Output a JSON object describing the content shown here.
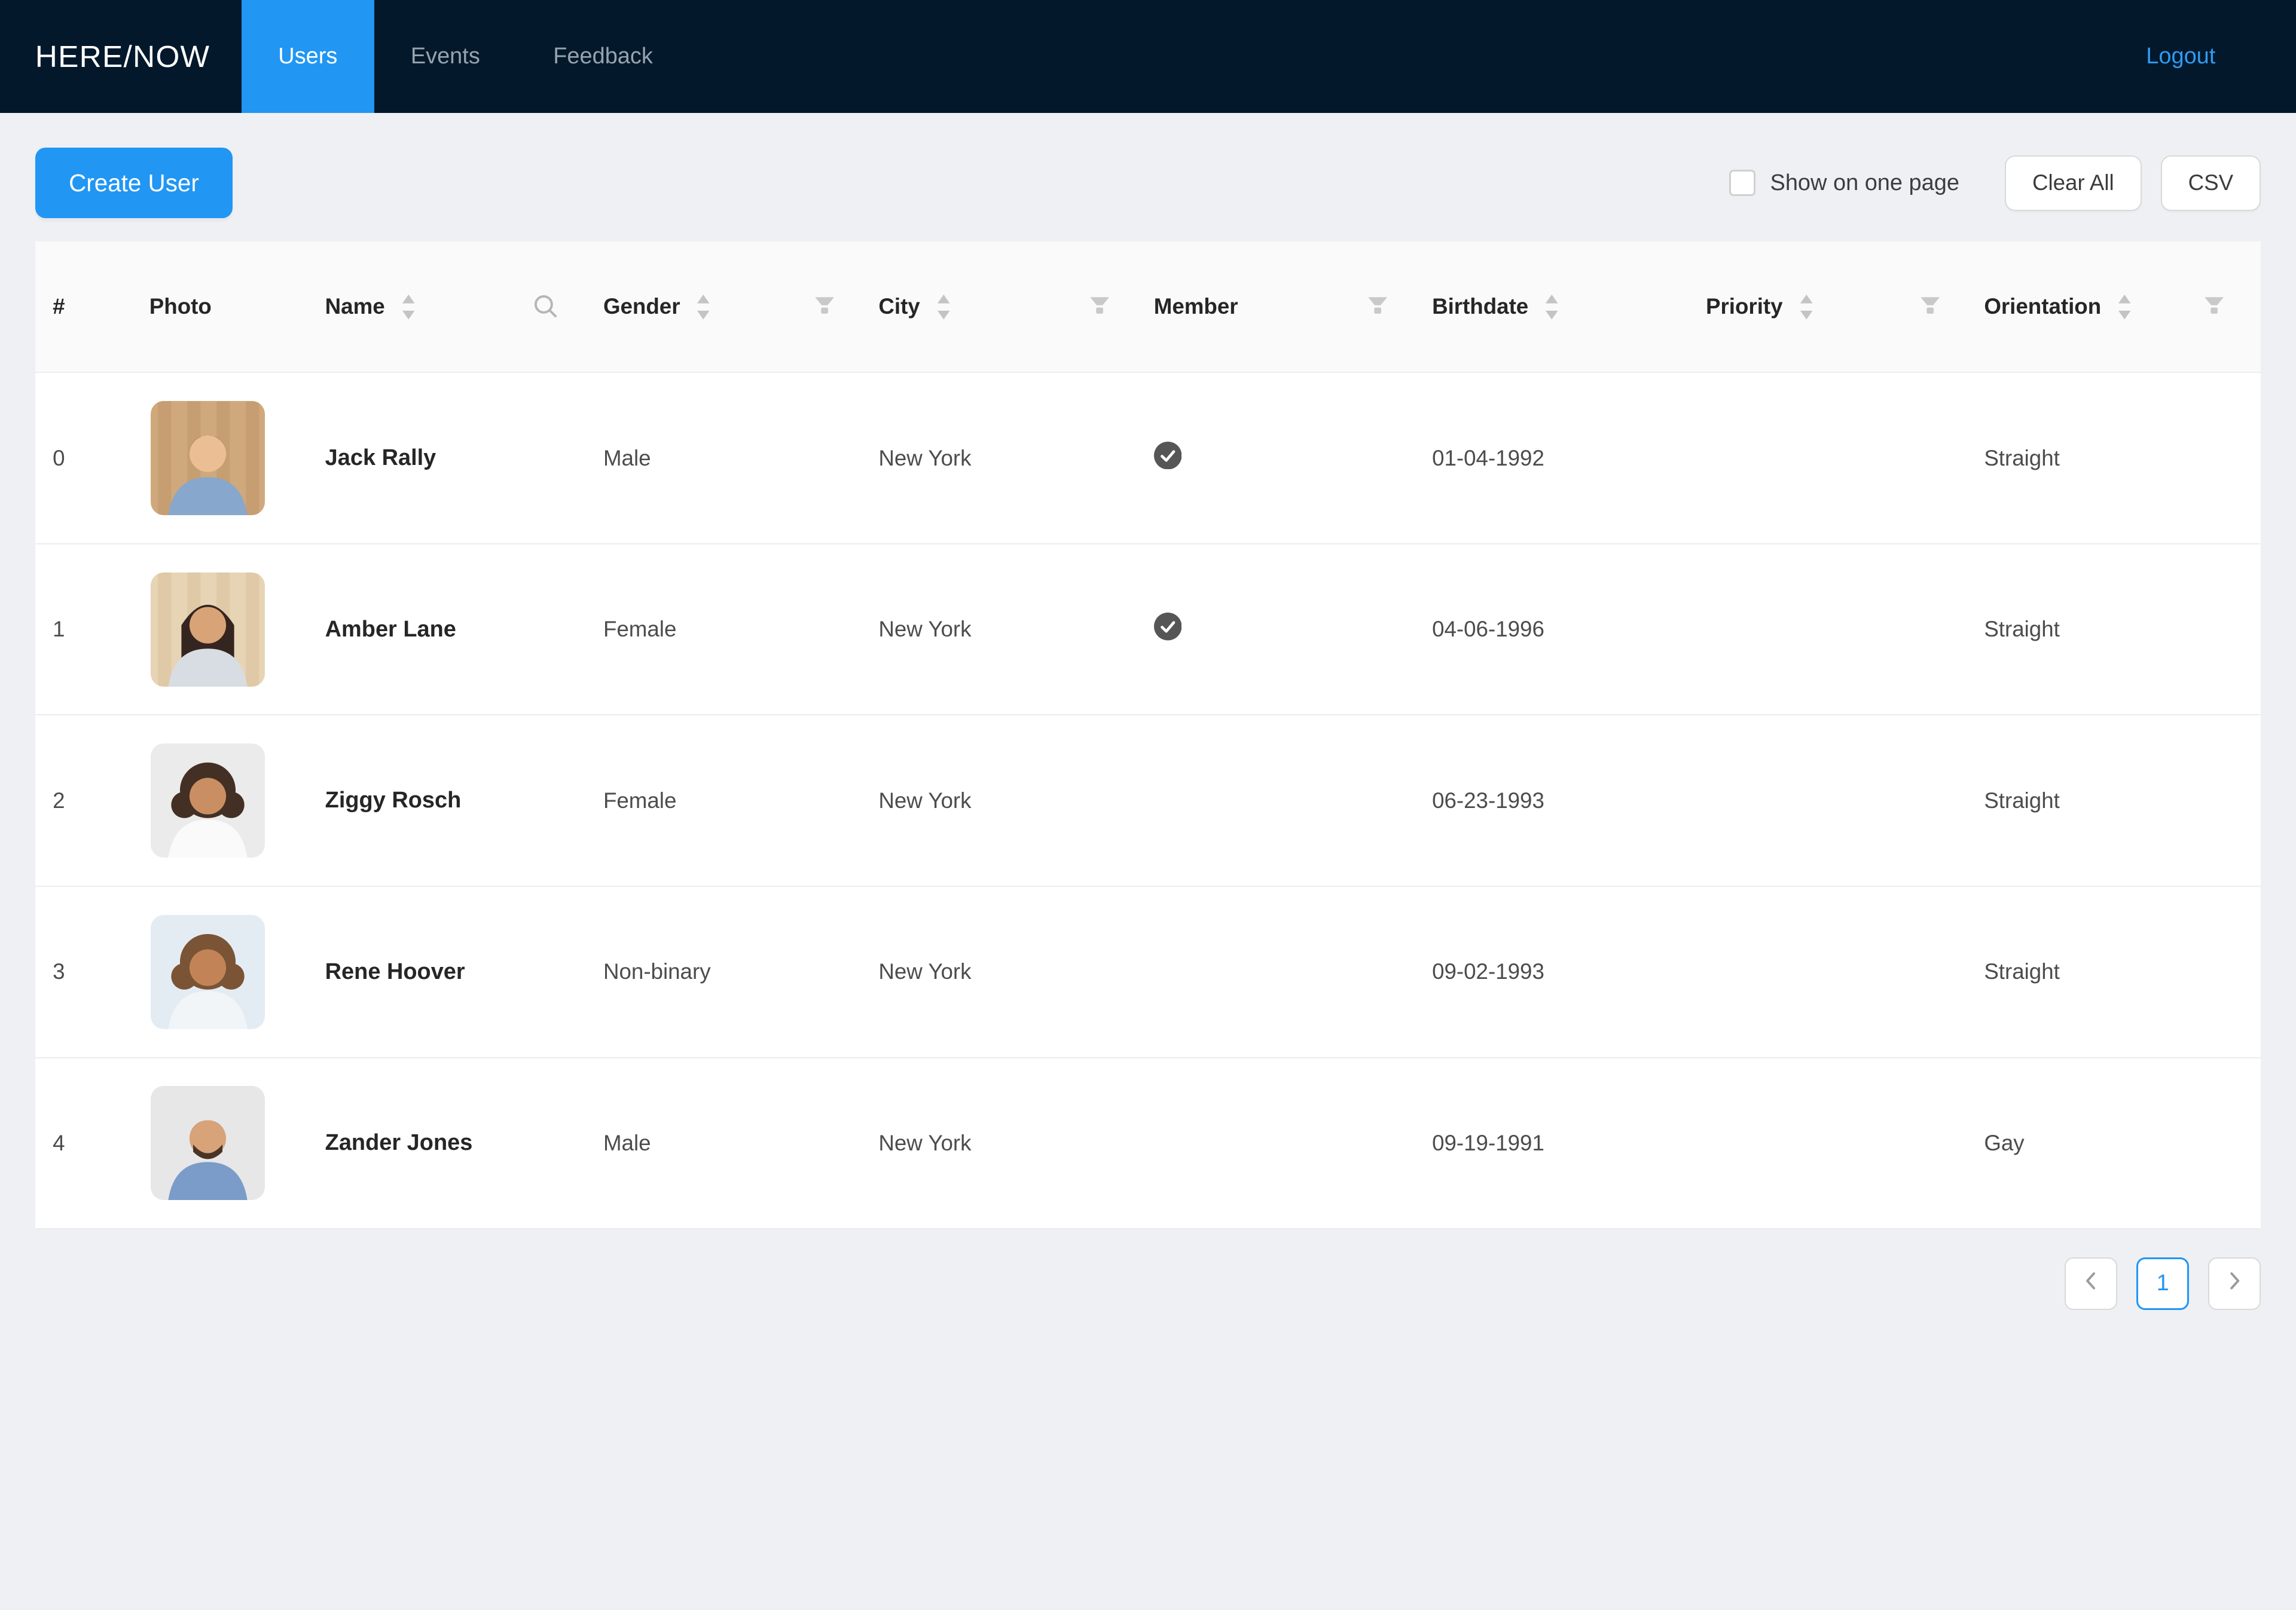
{
  "navbar": {
    "logo": "HERE/NOW",
    "tabs": [
      {
        "label": "Users",
        "active": true
      },
      {
        "label": "Events",
        "active": false
      },
      {
        "label": "Feedback",
        "active": false
      }
    ],
    "logout_label": "Logout",
    "colors": {
      "bg": "#04182b",
      "accent": "#2196f3",
      "inactive_tab_text": "#97a3ae"
    }
  },
  "toolbar": {
    "create_user_label": "Create User",
    "show_on_one_page_label": "Show on one page",
    "show_on_one_page_checked": false,
    "clear_all_label": "Clear All",
    "csv_label": "CSV"
  },
  "table": {
    "columns": [
      {
        "key": "index",
        "label": "#"
      },
      {
        "key": "photo",
        "label": "Photo"
      },
      {
        "key": "name",
        "label": "Name",
        "sorter": true,
        "search": true
      },
      {
        "key": "gender",
        "label": "Gender",
        "sorter": true,
        "filter": true
      },
      {
        "key": "city",
        "label": "City",
        "sorter": true,
        "filter": true
      },
      {
        "key": "member",
        "label": "Member",
        "filter": true
      },
      {
        "key": "birthdate",
        "label": "Birthdate",
        "sorter": true
      },
      {
        "key": "priority",
        "label": "Priority",
        "sorter": true,
        "filter": true
      },
      {
        "key": "orientation",
        "label": "Orientation",
        "sorter": true,
        "filter": true
      }
    ],
    "rows": [
      {
        "index": "0",
        "name": "Jack Rally",
        "gender": "Male",
        "city": "New York",
        "member": true,
        "birthdate": "01-04-1992",
        "priority": "",
        "orientation": "Straight",
        "avatar": {
          "style": "short",
          "bg": "#cfa97c",
          "texture": "#bb9164",
          "skin": "#ecbe94",
          "hair": "#28211c",
          "shirt": "#87a7cd"
        }
      },
      {
        "index": "1",
        "name": "Amber Lane",
        "gender": "Female",
        "city": "New York",
        "member": true,
        "birthdate": "04-06-1996",
        "priority": "",
        "orientation": "Straight",
        "avatar": {
          "style": "long",
          "bg": "#e7d4b5",
          "texture": "#d5bd97",
          "skin": "#d8a377",
          "hair": "#342520",
          "shirt": "#d7dde2"
        }
      },
      {
        "index": "2",
        "name": "Ziggy Rosch",
        "gender": "Female",
        "city": "New York",
        "member": false,
        "birthdate": "06-23-1993",
        "priority": "",
        "orientation": "Straight",
        "avatar": {
          "style": "curly",
          "bg": "#ebebeb",
          "texture": "",
          "skin": "#c98f63",
          "hair": "#432f24",
          "shirt": "#fafafa"
        }
      },
      {
        "index": "3",
        "name": "Rene Hoover",
        "gender": "Non-binary",
        "city": "New York",
        "member": false,
        "birthdate": "09-02-1993",
        "priority": "",
        "orientation": "Straight",
        "avatar": {
          "style": "curly",
          "bg": "#e3ecf3",
          "texture": "",
          "skin": "#c28457",
          "hair": "#7a5435",
          "shirt": "#f2f5f7"
        }
      },
      {
        "index": "4",
        "name": "Zander Jones",
        "gender": "Male",
        "city": "New York",
        "member": false,
        "birthdate": "09-19-1991",
        "priority": "",
        "orientation": "Gay",
        "avatar": {
          "style": "beard",
          "bg": "#e7e7e7",
          "texture": "",
          "skin": "#d9a379",
          "hair": "#4a3425",
          "shirt": "#7b9cc9"
        }
      }
    ],
    "member_icon_color": "#565656",
    "icon_color": "#c4c4c4"
  },
  "pagination": {
    "current": "1"
  }
}
